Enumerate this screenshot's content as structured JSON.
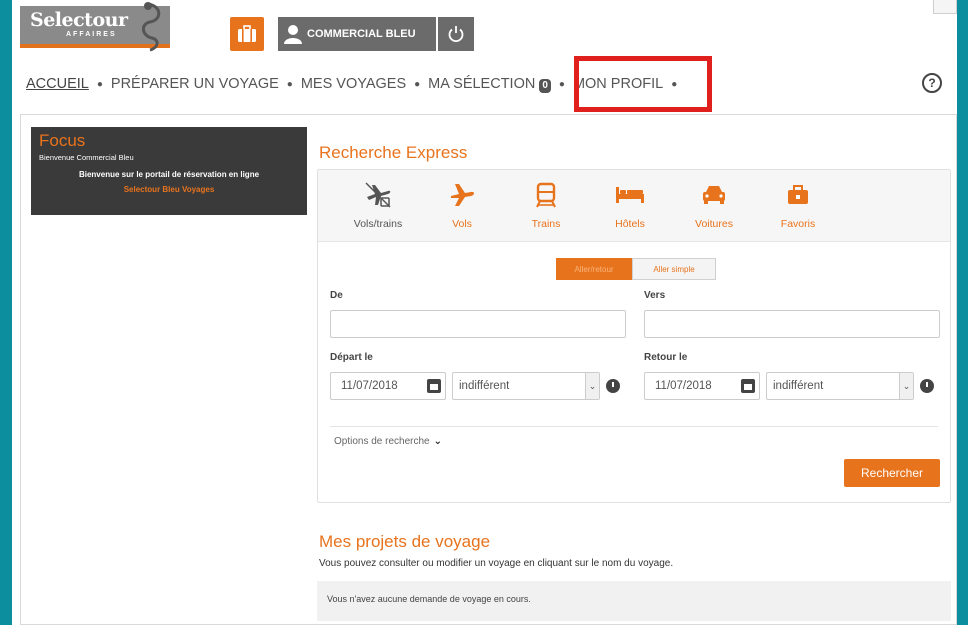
{
  "header": {
    "logo": {
      "brand": "Selectour",
      "sub": "AFFAIRES"
    },
    "user_name": "COMMERCIAL BLEU",
    "nav": [
      {
        "label": "ACCUEIL"
      },
      {
        "label": "PRÉPARER UN VOYAGE"
      },
      {
        "label": "MES VOYAGES"
      },
      {
        "label": "MA SÉLECTION",
        "badge": "0"
      },
      {
        "label": "MON PROFIL"
      }
    ],
    "help_label": "?"
  },
  "focus": {
    "title": "Focus",
    "welcome": "Bienvenue Commercial Bleu",
    "message": "Bienvenue sur le portail de réservation en ligne",
    "link": "Selectour Bleu Voyages"
  },
  "search": {
    "title": "Recherche Express",
    "tabs": [
      {
        "label": "Vols/trains",
        "icon": "plane-train-icon"
      },
      {
        "label": "Vols",
        "icon": "plane-icon"
      },
      {
        "label": "Trains",
        "icon": "train-icon"
      },
      {
        "label": "Hôtels",
        "icon": "bed-icon"
      },
      {
        "label": "Voitures",
        "icon": "car-icon"
      },
      {
        "label": "Favoris",
        "icon": "briefcase-icon"
      }
    ],
    "trip_type": {
      "round": "Aller/retour",
      "single": "Aller simple"
    },
    "from_label": "De",
    "to_label": "Vers",
    "depart_label": "Départ le",
    "return_label": "Retour le",
    "depart_date": "11/07/2018",
    "return_date": "11/07/2018",
    "depart_time": "indifférent",
    "return_time": "indifférent",
    "options_label": "Options de recherche",
    "submit_label": "Rechercher"
  },
  "projects": {
    "title": "Mes projets de voyage",
    "description": "Vous pouvez consulter ou modifier un voyage en cliquant sur le nom du voyage.",
    "empty": "Vous n'avez aucune demande de voyage en cours."
  },
  "colors": {
    "accent": "#e8731d",
    "highlight": "#e0201d",
    "frame": "#0d8e9e"
  }
}
